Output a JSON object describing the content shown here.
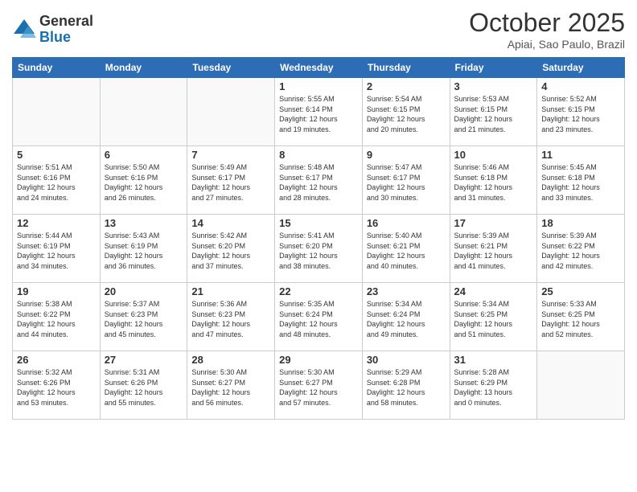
{
  "logo": {
    "general": "General",
    "blue": "Blue"
  },
  "header": {
    "title": "October 2025",
    "subtitle": "Apiai, Sao Paulo, Brazil"
  },
  "weekdays": [
    "Sunday",
    "Monday",
    "Tuesday",
    "Wednesday",
    "Thursday",
    "Friday",
    "Saturday"
  ],
  "weeks": [
    [
      {
        "day": "",
        "info": ""
      },
      {
        "day": "",
        "info": ""
      },
      {
        "day": "",
        "info": ""
      },
      {
        "day": "1",
        "info": "Sunrise: 5:55 AM\nSunset: 6:14 PM\nDaylight: 12 hours\nand 19 minutes."
      },
      {
        "day": "2",
        "info": "Sunrise: 5:54 AM\nSunset: 6:15 PM\nDaylight: 12 hours\nand 20 minutes."
      },
      {
        "day": "3",
        "info": "Sunrise: 5:53 AM\nSunset: 6:15 PM\nDaylight: 12 hours\nand 21 minutes."
      },
      {
        "day": "4",
        "info": "Sunrise: 5:52 AM\nSunset: 6:15 PM\nDaylight: 12 hours\nand 23 minutes."
      }
    ],
    [
      {
        "day": "5",
        "info": "Sunrise: 5:51 AM\nSunset: 6:16 PM\nDaylight: 12 hours\nand 24 minutes."
      },
      {
        "day": "6",
        "info": "Sunrise: 5:50 AM\nSunset: 6:16 PM\nDaylight: 12 hours\nand 26 minutes."
      },
      {
        "day": "7",
        "info": "Sunrise: 5:49 AM\nSunset: 6:17 PM\nDaylight: 12 hours\nand 27 minutes."
      },
      {
        "day": "8",
        "info": "Sunrise: 5:48 AM\nSunset: 6:17 PM\nDaylight: 12 hours\nand 28 minutes."
      },
      {
        "day": "9",
        "info": "Sunrise: 5:47 AM\nSunset: 6:17 PM\nDaylight: 12 hours\nand 30 minutes."
      },
      {
        "day": "10",
        "info": "Sunrise: 5:46 AM\nSunset: 6:18 PM\nDaylight: 12 hours\nand 31 minutes."
      },
      {
        "day": "11",
        "info": "Sunrise: 5:45 AM\nSunset: 6:18 PM\nDaylight: 12 hours\nand 33 minutes."
      }
    ],
    [
      {
        "day": "12",
        "info": "Sunrise: 5:44 AM\nSunset: 6:19 PM\nDaylight: 12 hours\nand 34 minutes."
      },
      {
        "day": "13",
        "info": "Sunrise: 5:43 AM\nSunset: 6:19 PM\nDaylight: 12 hours\nand 36 minutes."
      },
      {
        "day": "14",
        "info": "Sunrise: 5:42 AM\nSunset: 6:20 PM\nDaylight: 12 hours\nand 37 minutes."
      },
      {
        "day": "15",
        "info": "Sunrise: 5:41 AM\nSunset: 6:20 PM\nDaylight: 12 hours\nand 38 minutes."
      },
      {
        "day": "16",
        "info": "Sunrise: 5:40 AM\nSunset: 6:21 PM\nDaylight: 12 hours\nand 40 minutes."
      },
      {
        "day": "17",
        "info": "Sunrise: 5:39 AM\nSunset: 6:21 PM\nDaylight: 12 hours\nand 41 minutes."
      },
      {
        "day": "18",
        "info": "Sunrise: 5:39 AM\nSunset: 6:22 PM\nDaylight: 12 hours\nand 42 minutes."
      }
    ],
    [
      {
        "day": "19",
        "info": "Sunrise: 5:38 AM\nSunset: 6:22 PM\nDaylight: 12 hours\nand 44 minutes."
      },
      {
        "day": "20",
        "info": "Sunrise: 5:37 AM\nSunset: 6:23 PM\nDaylight: 12 hours\nand 45 minutes."
      },
      {
        "day": "21",
        "info": "Sunrise: 5:36 AM\nSunset: 6:23 PM\nDaylight: 12 hours\nand 47 minutes."
      },
      {
        "day": "22",
        "info": "Sunrise: 5:35 AM\nSunset: 6:24 PM\nDaylight: 12 hours\nand 48 minutes."
      },
      {
        "day": "23",
        "info": "Sunrise: 5:34 AM\nSunset: 6:24 PM\nDaylight: 12 hours\nand 49 minutes."
      },
      {
        "day": "24",
        "info": "Sunrise: 5:34 AM\nSunset: 6:25 PM\nDaylight: 12 hours\nand 51 minutes."
      },
      {
        "day": "25",
        "info": "Sunrise: 5:33 AM\nSunset: 6:25 PM\nDaylight: 12 hours\nand 52 minutes."
      }
    ],
    [
      {
        "day": "26",
        "info": "Sunrise: 5:32 AM\nSunset: 6:26 PM\nDaylight: 12 hours\nand 53 minutes."
      },
      {
        "day": "27",
        "info": "Sunrise: 5:31 AM\nSunset: 6:26 PM\nDaylight: 12 hours\nand 55 minutes."
      },
      {
        "day": "28",
        "info": "Sunrise: 5:30 AM\nSunset: 6:27 PM\nDaylight: 12 hours\nand 56 minutes."
      },
      {
        "day": "29",
        "info": "Sunrise: 5:30 AM\nSunset: 6:27 PM\nDaylight: 12 hours\nand 57 minutes."
      },
      {
        "day": "30",
        "info": "Sunrise: 5:29 AM\nSunset: 6:28 PM\nDaylight: 12 hours\nand 58 minutes."
      },
      {
        "day": "31",
        "info": "Sunrise: 5:28 AM\nSunset: 6:29 PM\nDaylight: 13 hours\nand 0 minutes."
      },
      {
        "day": "",
        "info": ""
      }
    ]
  ]
}
